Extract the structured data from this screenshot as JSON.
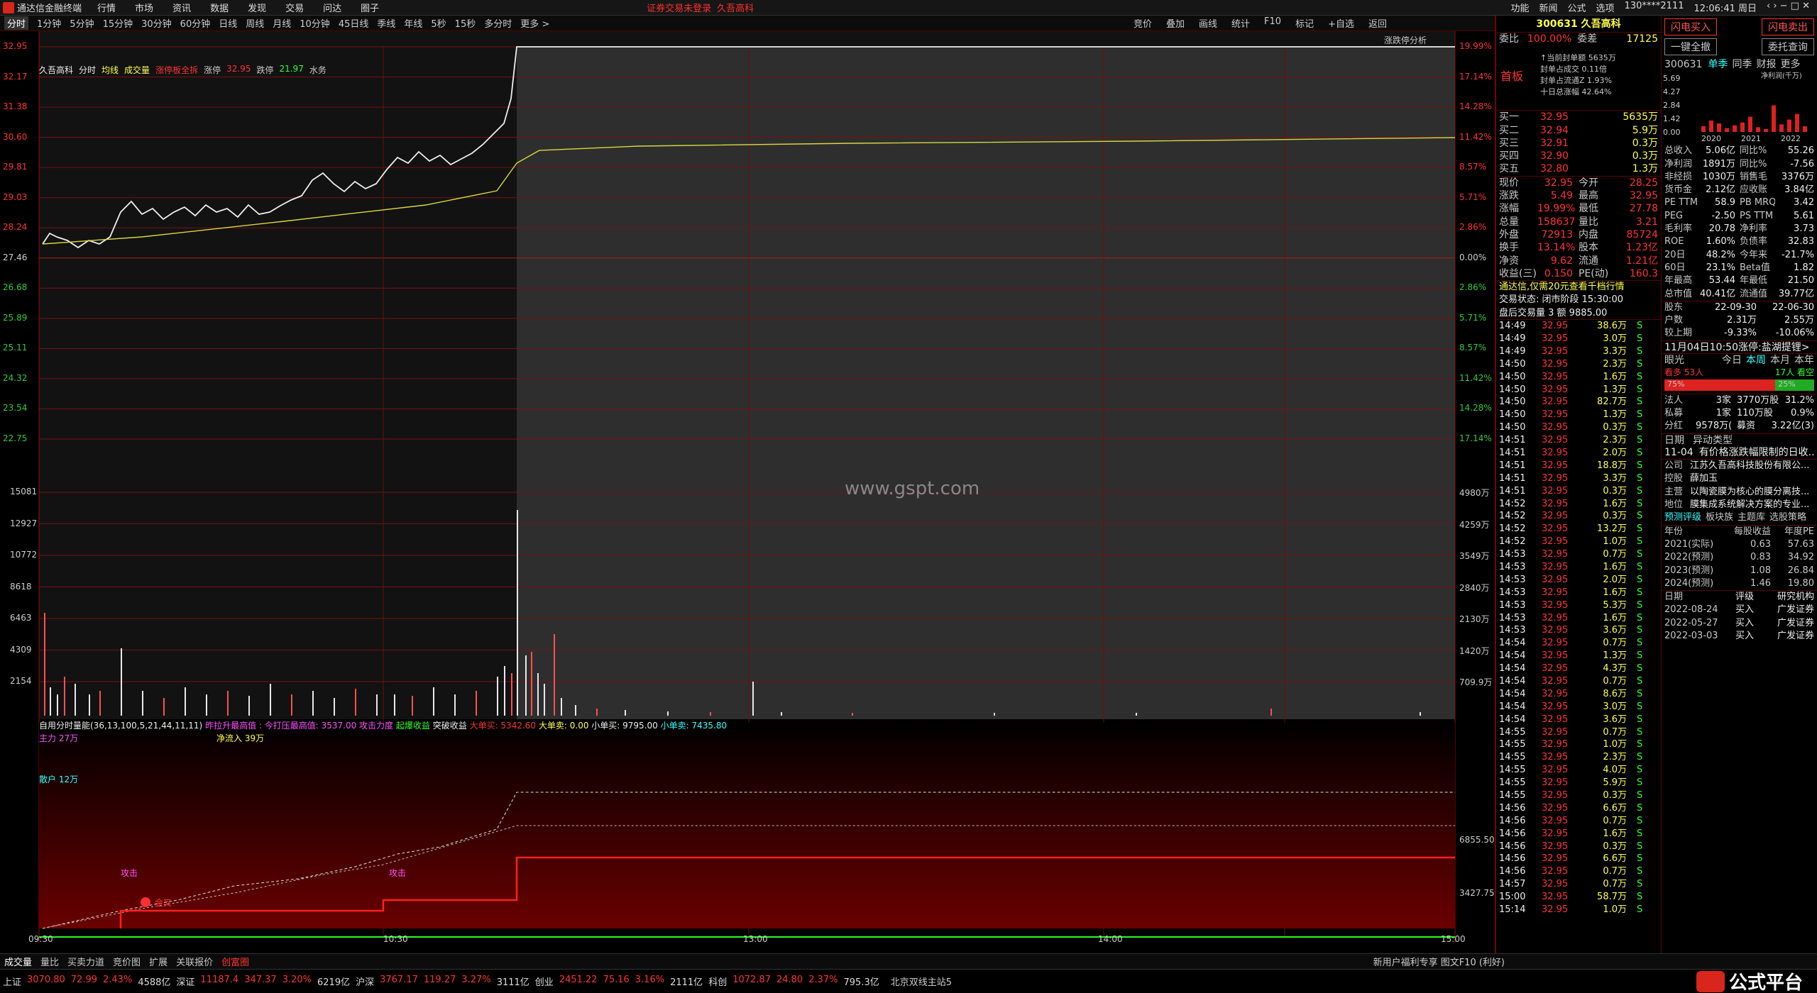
{
  "menubar": {
    "app": "通达信金融终端",
    "items": [
      "行情",
      "市场",
      "资讯",
      "数据",
      "发现",
      "交易",
      "问达",
      "圈子"
    ],
    "warn": "证券交易未登录",
    "stock": "久吾高科",
    "right": [
      "功能",
      "新闻",
      "公式",
      "选项",
      "130****2111",
      "12:06:41 周日"
    ]
  },
  "periods": [
    "分时",
    "1分钟",
    "5分钟",
    "15分钟",
    "30分钟",
    "60分钟",
    "日线",
    "周线",
    "月线",
    "10分钟",
    "45日线",
    "季线",
    "年线",
    "5秒",
    "15秒",
    "多分时",
    "更多 >"
  ],
  "tools": [
    "竞价",
    "叠加",
    "画线",
    "统计",
    "F10",
    "标记",
    "+自选",
    "返回"
  ],
  "chart_legend": [
    "久吾高科",
    "分时",
    "均线",
    "成交量",
    "涨停板全拆",
    "涨停",
    "32.95",
    "跌停",
    "21.97",
    "水务"
  ],
  "indicator": {
    "name": "自用分时量能(36,13,100,5,21,44,11,11)",
    "a": "昨拉升最高值 : 今打压最高值: 3537.00",
    "b": "攻击力度",
    "c": "起爆收益",
    "d": "突破收益",
    "e": "大单买: 5342.60",
    "f": "大单卖: 0.00",
    "g": "小单买: 9795.00",
    "h": "小单卖: 7435.80",
    "main": "主力 27万",
    "net": "净流入 39万",
    "retail": "散户 12万",
    "attack": "攻击",
    "buy": "金叉"
  },
  "tr_label": "涨跌停分析",
  "ylabels_price": [
    "32.95",
    "32.17",
    "31.38",
    "30.60",
    "29.81",
    "29.03",
    "28.24",
    "27.46",
    "26.68",
    "25.89",
    "25.11",
    "24.32",
    "23.54",
    "22.75"
  ],
  "ylabels_pct": [
    "19.99%",
    "17.14%",
    "14.28%",
    "11.42%",
    "8.57%",
    "5.71%",
    "2.86%",
    "0.00%",
    "2.86%",
    "5.71%",
    "8.57%",
    "11.42%",
    "14.28%",
    "17.14%"
  ],
  "vol_left": [
    "15081",
    "12927",
    "10772",
    "8618",
    "6463",
    "4309",
    "2154"
  ],
  "vol_right": [
    "4980万",
    "4259万",
    "3549万",
    "2840万",
    "2130万",
    "1420万",
    "709.9万"
  ],
  "ind_right": [
    "6855.50",
    "3427.75"
  ],
  "time_labels": [
    "09:30",
    "10:30",
    "13:00",
    "14:00",
    "15:00"
  ],
  "watermark": "www.gspt.com",
  "panel": {
    "code": "300631",
    "name": "久吾高科",
    "wb_label": "委比",
    "wb": "100.00%",
    "wc_label": "委差",
    "wc": "17125",
    "board": "首板",
    "seal": [
      "↑当前封单额 5635万",
      "封单占成交 0.11倍",
      "封单占流通Z 1.93%",
      "十日总涨幅 42.64%"
    ],
    "bids": [
      [
        "买一",
        "32.95",
        "5635万"
      ],
      [
        "买二",
        "32.94",
        "5.9万"
      ],
      [
        "买三",
        "32.91",
        "0.3万"
      ],
      [
        "买四",
        "32.90",
        "0.3万"
      ],
      [
        "买五",
        "32.80",
        "1.3万"
      ]
    ],
    "quote": [
      [
        "现价",
        "32.95",
        "今开",
        "28.25"
      ],
      [
        "涨跌",
        "5.49",
        "最高",
        "32.95"
      ],
      [
        "涨幅",
        "19.99%",
        "最低",
        "27.78"
      ],
      [
        "总量",
        "158637",
        "量比",
        "3.21"
      ],
      [
        "外盘",
        "72913",
        "内盘",
        "85724"
      ],
      [
        "换手",
        "13.14%",
        "股本",
        "1.23亿"
      ],
      [
        "净资",
        "9.62",
        "流通",
        "1.21亿"
      ],
      [
        "收益(三)",
        "0.150",
        "PE(动)",
        "160.3"
      ]
    ],
    "ad": "通达信,仅需20元查看千档行情",
    "state": "交易状态: 闭市阶段 15:30:00",
    "after": "盘后交易量 3 额 9885.00",
    "ticks": [
      [
        "14:49",
        "32.95",
        "38.6万"
      ],
      [
        "14:49",
        "32.95",
        "3.0万"
      ],
      [
        "14:49",
        "32.95",
        "3.3万"
      ],
      [
        "14:50",
        "32.95",
        "2.3万"
      ],
      [
        "14:50",
        "32.95",
        "1.6万"
      ],
      [
        "14:50",
        "32.95",
        "1.3万"
      ],
      [
        "14:50",
        "32.95",
        "82.7万"
      ],
      [
        "14:50",
        "32.95",
        "1.3万"
      ],
      [
        "14:50",
        "32.95",
        "0.3万"
      ],
      [
        "14:51",
        "32.95",
        "2.3万"
      ],
      [
        "14:51",
        "32.95",
        "2.0万"
      ],
      [
        "14:51",
        "32.95",
        "18.8万"
      ],
      [
        "14:51",
        "32.95",
        "3.3万"
      ],
      [
        "14:51",
        "32.95",
        "0.3万"
      ],
      [
        "14:52",
        "32.95",
        "1.6万"
      ],
      [
        "14:52",
        "32.95",
        "0.3万"
      ],
      [
        "14:52",
        "32.95",
        "13.2万"
      ],
      [
        "14:52",
        "32.95",
        "1.0万"
      ],
      [
        "14:53",
        "32.95",
        "0.7万"
      ],
      [
        "14:53",
        "32.95",
        "1.6万"
      ],
      [
        "14:53",
        "32.95",
        "2.0万"
      ],
      [
        "14:53",
        "32.95",
        "1.6万"
      ],
      [
        "14:53",
        "32.95",
        "5.3万"
      ],
      [
        "14:53",
        "32.95",
        "1.6万"
      ],
      [
        "14:53",
        "32.95",
        "3.6万"
      ],
      [
        "14:54",
        "32.95",
        "0.7万"
      ],
      [
        "14:54",
        "32.95",
        "1.3万"
      ],
      [
        "14:54",
        "32.95",
        "4.3万"
      ],
      [
        "14:54",
        "32.95",
        "0.7万"
      ],
      [
        "14:54",
        "32.95",
        "8.6万"
      ],
      [
        "14:54",
        "32.95",
        "3.0万"
      ],
      [
        "14:54",
        "32.95",
        "3.6万"
      ],
      [
        "14:55",
        "32.95",
        "0.7万"
      ],
      [
        "14:55",
        "32.95",
        "1.0万"
      ],
      [
        "14:55",
        "32.95",
        "2.3万"
      ],
      [
        "14:55",
        "32.95",
        "4.0万"
      ],
      [
        "14:55",
        "32.95",
        "5.9万"
      ],
      [
        "14:55",
        "32.95",
        "0.3万"
      ],
      [
        "14:56",
        "32.95",
        "6.6万"
      ],
      [
        "14:56",
        "32.95",
        "0.7万"
      ],
      [
        "14:56",
        "32.95",
        "1.6万"
      ],
      [
        "14:56",
        "32.95",
        "0.3万"
      ],
      [
        "14:56",
        "32.95",
        "6.6万"
      ],
      [
        "14:56",
        "32.95",
        "0.7万"
      ],
      [
        "14:57",
        "32.95",
        "0.7万"
      ],
      [
        "15:00",
        "32.95",
        "58.7万"
      ],
      [
        "15:14",
        "32.95",
        "1.0万"
      ]
    ]
  },
  "side": {
    "code": "300631",
    "tabs": [
      "单季",
      "同季",
      "财报",
      "更多"
    ],
    "unit": "净利润(千万)",
    "years": [
      "2020",
      "2021",
      "2022"
    ],
    "yaxis": [
      "5.69",
      "4.27",
      "2.84",
      "1.42",
      "0.00"
    ],
    "bars": [
      0.6,
      1.2,
      0.9,
      0.4,
      0.7,
      1.0,
      1.6,
      0.5,
      0.3,
      2.8,
      0.8,
      1.3,
      1.9,
      0.6
    ],
    "fin": [
      [
        "总收入",
        "5.06亿",
        "同比%",
        "55.26"
      ],
      [
        "净利润",
        "1891万",
        "同比%",
        "-7.56"
      ],
      [
        "非经损",
        "1030万",
        "销售毛",
        "3376万"
      ],
      [
        "货币金",
        "2.12亿",
        "应收账",
        "3.84亿"
      ],
      [
        "PE TTM",
        "58.9",
        "PB MRQ",
        "3.42"
      ],
      [
        "PEG",
        "-2.50",
        "PS TTM",
        "5.61"
      ],
      [
        "毛利率",
        "20.78",
        "净利率",
        "3.73"
      ],
      [
        "ROE",
        "1.60%",
        "负债率",
        "32.83"
      ],
      [
        "20日",
        "48.2%",
        "今年来",
        "-21.7%"
      ],
      [
        "60日",
        "23.1%",
        "Beta值",
        "1.82"
      ],
      [
        "年最高",
        "53.44",
        "年最低",
        "21.50"
      ],
      [
        "总市值",
        "40.41亿",
        "流通值",
        "39.77亿"
      ]
    ],
    "holders": [
      [
        "股东",
        "22-09-30",
        "22-06-30"
      ],
      [
        "户数",
        "2.31万",
        "2.55万"
      ],
      [
        "较上期",
        "-9.33%",
        "-10.06%"
      ]
    ],
    "news": "11月04日10:50涨停:盐湖提锂>",
    "view": [
      "眼光",
      "今日",
      "本周",
      "本月",
      "本年"
    ],
    "bull": "看多 53人",
    "bear": "17人 看空",
    "bullp": "75%",
    "bearp": "25%",
    "inst": [
      [
        "法人",
        "3家",
        "3770万股",
        "31.2%"
      ],
      [
        "私募",
        "1家",
        "110万股",
        "0.9%"
      ],
      [
        "分红",
        "9578万(6)",
        "募资",
        "3.22亿(3)"
      ]
    ],
    "event_hdr": [
      "日期",
      "异动类型"
    ],
    "event": [
      "11-04",
      "有价格涨跌幅限制的日收..."
    ],
    "corp": [
      [
        "公司",
        "江苏久吾高科技股份有限公..."
      ],
      [
        "控股",
        "薛加玉"
      ],
      [
        "主营",
        "以陶瓷膜为核心的膜分离技..."
      ],
      [
        "地位",
        "膜集成系统解决方案的专业..."
      ]
    ],
    "links": [
      "预测评级",
      "板块族",
      "主题库",
      "选股策略"
    ],
    "pred_hdr": [
      "年份",
      "每股收益",
      "年度PE"
    ],
    "pred": [
      [
        "2021(实际)",
        "0.63",
        "57.63"
      ],
      [
        "2022(预测)",
        "0.83",
        "34.92"
      ],
      [
        "2023(预测)",
        "1.08",
        "26.84"
      ],
      [
        "2024(预测)",
        "1.46",
        "19.80"
      ]
    ],
    "rate_hdr": [
      "日期",
      "评级",
      "研究机构"
    ],
    "rate": [
      [
        "2022-08-24",
        "买入",
        "广发证券"
      ],
      [
        "2022-05-27",
        "买入",
        "广发证券"
      ],
      [
        "2022-03-03",
        "买入",
        "广发证券"
      ]
    ],
    "btns": [
      "闪电买入",
      "闪电卖出",
      "一键全撤",
      "委托查询"
    ]
  },
  "bottom": [
    "成交量",
    "量比",
    "买卖力道",
    "竞价图",
    "扩展",
    "关联报价",
    "创富圈"
  ],
  "bottom_right": [
    "新用户福利专享 图文F10 (利好)"
  ],
  "status": [
    [
      "上证",
      "3070.80",
      "72.99",
      "2.43%",
      "4588亿"
    ],
    [
      "深证",
      "11187.4",
      "347.37",
      "3.20%",
      "6219亿"
    ],
    [
      "沪深",
      "3767.17",
      "119.27",
      "3.27%",
      "3111亿"
    ],
    [
      "创业",
      "2451.22",
      "75.16",
      "3.16%",
      "2111亿"
    ],
    [
      "科创",
      "1072.87",
      "24.80",
      "2.37%",
      "795.3亿"
    ]
  ],
  "status_extra": "北京双线主站5",
  "logo": "公式平台",
  "logo_sub": "www.gspt.com"
}
